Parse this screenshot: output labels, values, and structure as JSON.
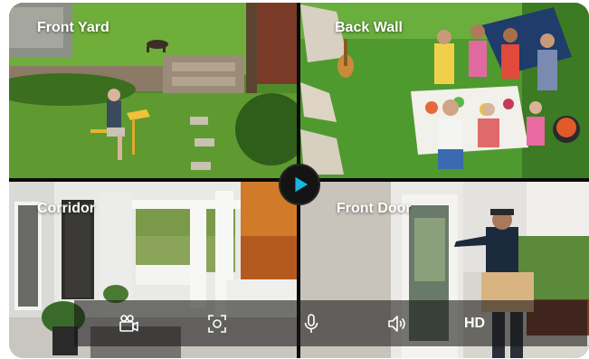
{
  "cameras": [
    {
      "id": "front-yard",
      "label": "Front Yard"
    },
    {
      "id": "back-wall",
      "label": "Back Wall"
    },
    {
      "id": "corridor",
      "label": "Corridor"
    },
    {
      "id": "front-door",
      "label": "Front Door"
    }
  ],
  "play_button": {
    "icon": "play-icon",
    "color": "#15b7e0"
  },
  "toolbar": {
    "items": [
      {
        "icon": "video-camera-icon"
      },
      {
        "icon": "snapshot-icon"
      },
      {
        "icon": "microphone-icon"
      },
      {
        "icon": "speaker-icon"
      },
      {
        "label": "HD"
      }
    ]
  }
}
